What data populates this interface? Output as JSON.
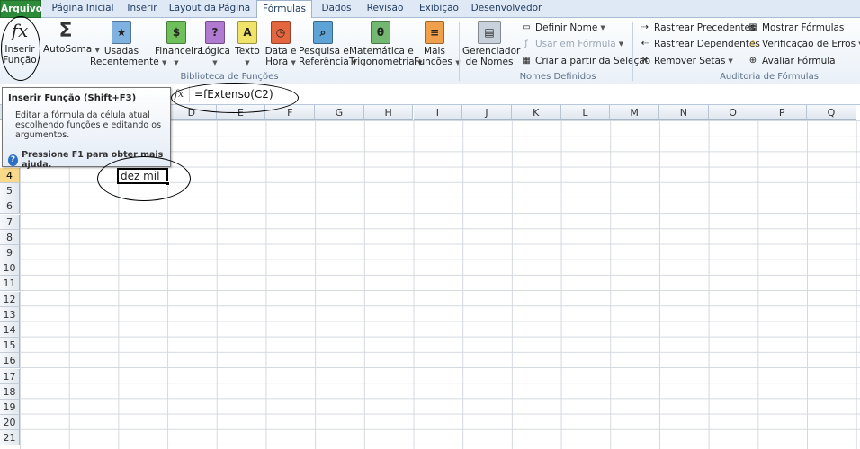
{
  "tabs": [
    {
      "label": "Arquivo"
    },
    {
      "label": "Página Inicial"
    },
    {
      "label": "Inserir"
    },
    {
      "label": "Layout da Página"
    },
    {
      "label": "Fórmulas"
    },
    {
      "label": "Dados"
    },
    {
      "label": "Revisão"
    },
    {
      "label": "Exibição"
    },
    {
      "label": "Desenvolvedor"
    }
  ],
  "ribbon": {
    "insert_function": {
      "line1": "Inserir",
      "line2": "Função"
    },
    "autosum": "AutoSoma",
    "recent": {
      "line1": "Usadas",
      "line2": "Recentemente"
    },
    "financial": "Financeira",
    "logical": "Lógica",
    "text": "Texto",
    "datetime": {
      "line1": "Data e",
      "line2": "Hora"
    },
    "lookup": {
      "line1": "Pesquisa e",
      "line2": "Referência"
    },
    "math": {
      "line1": "Matemática e",
      "line2": "Trigonometria"
    },
    "more": {
      "line1": "Mais",
      "line2": "Funções"
    },
    "group_library": "Biblioteca de Funções",
    "name_manager": {
      "line1": "Gerenciador",
      "line2": "de Nomes"
    },
    "define_name": "Definir Nome",
    "use_in_formula": "Usar em Fórmula",
    "create_from_selection": "Criar a partir da Seleção",
    "group_names": "Nomes Definidos",
    "trace_precedents": "Rastrear Precedentes",
    "trace_dependents": "Rastrear Dependentes",
    "remove_arrows": "Remover Setas",
    "show_formulas": "Mostrar Fórmulas",
    "error_checking": "Verificação de Erros",
    "evaluate_formula": "Avaliar Fórmula",
    "group_audit": "Auditoria de Fórmulas"
  },
  "tooltip": {
    "title": "Inserir Função (Shift+F3)",
    "body": "Editar a fórmula da célula atual escolhendo funções e editando os argumentos.",
    "help": "Pressione F1 para obter mais ajuda."
  },
  "formula_bar": {
    "fx": "fx",
    "formula": "=fExtenso(C2)"
  },
  "grid": {
    "columns": [
      "D",
      "E",
      "F",
      "G",
      "H",
      "I",
      "J",
      "K",
      "L",
      "M",
      "N",
      "O",
      "P",
      "Q"
    ],
    "rows": [
      "4",
      "5",
      "6",
      "7",
      "8",
      "9",
      "10",
      "11",
      "12",
      "13",
      "14",
      "15",
      "16",
      "17",
      "18",
      "19",
      "20",
      "21"
    ],
    "active_cell_value": "dez mil"
  }
}
